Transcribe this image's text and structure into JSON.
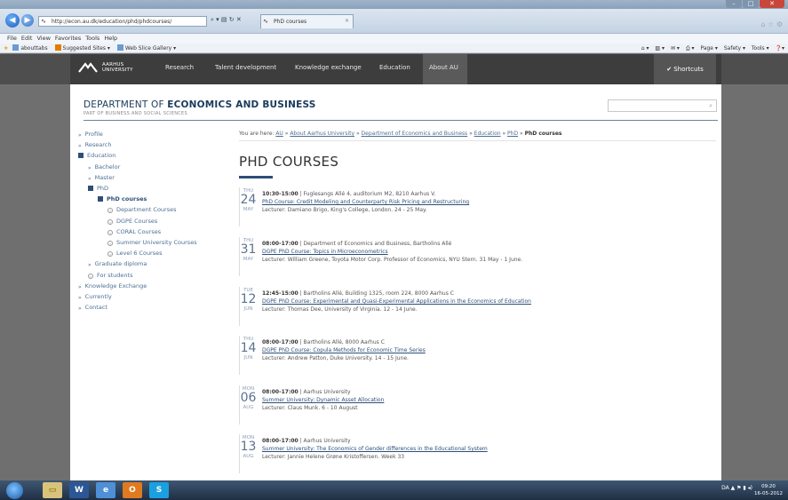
{
  "browser": {
    "url": "http://econ.au.dk/education/phd/phdcourses/",
    "tab_title": "PhD courses",
    "menu": [
      "File",
      "Edit",
      "View",
      "Favorites",
      "Tools",
      "Help"
    ],
    "favorites": [
      "abouttabs",
      "Suggested Sites ▾",
      "Web Slice Gallery ▾"
    ],
    "command_bar": [
      "Page ▾",
      "Safety ▾",
      "Tools ▾"
    ]
  },
  "site": {
    "logo_line1": "AARHUS",
    "logo_line2": "UNIVERSITY",
    "nav": [
      "Research",
      "Talent development",
      "Knowledge exchange",
      "Education",
      "About AU"
    ],
    "shortcuts": "✔ Shortcuts",
    "dept_prefix": "DEPARTMENT OF ",
    "dept_bold": "ECONOMICS AND BUSINESS",
    "faculty": "PART OF BUSINESS AND SOCIAL SCIENCES"
  },
  "sidebar": [
    {
      "label": "Profile",
      "marker": "arrow",
      "indent": 0
    },
    {
      "label": "Research",
      "marker": "arrow",
      "indent": 0
    },
    {
      "label": "Education",
      "marker": "box",
      "indent": 0
    },
    {
      "label": "Bachelor",
      "marker": "arrow",
      "indent": 1
    },
    {
      "label": "Master",
      "marker": "arrow",
      "indent": 1
    },
    {
      "label": "PhD",
      "marker": "box",
      "indent": 1
    },
    {
      "label": "PhD courses",
      "marker": "box",
      "indent": 2
    },
    {
      "label": "Department Courses",
      "marker": "circ",
      "indent": 3
    },
    {
      "label": "DGPE Courses",
      "marker": "circ",
      "indent": 3
    },
    {
      "label": "CORAL Courses",
      "marker": "circ",
      "indent": 3
    },
    {
      "label": "Summer University Courses",
      "marker": "circ",
      "indent": 3
    },
    {
      "label": "Level 6 Courses",
      "marker": "circ",
      "indent": 3
    },
    {
      "label": "Graduate diploma",
      "marker": "arrow",
      "indent": 1
    },
    {
      "label": "For students",
      "marker": "circ",
      "indent": 1
    },
    {
      "label": "Knowledge Exchange",
      "marker": "arrow",
      "indent": 0
    },
    {
      "label": "Currently",
      "marker": "arrow",
      "indent": 0
    },
    {
      "label": "Contact",
      "marker": "arrow",
      "indent": 0
    }
  ],
  "breadcrumb": {
    "prefix": "You are here:",
    "items": [
      "AU",
      "About Aarhus University",
      "Department of Economics and Business",
      "Education",
      "PhD"
    ],
    "current": "PhD courses"
  },
  "page_title": "PHD COURSES",
  "events": [
    {
      "dow": "THU",
      "day": "24",
      "mon": "MAY",
      "time": "10:30-15:00",
      "place": "| Fuglesangs Allé 4, auditorium M2, 8210 Aarhus V.",
      "title": "PhD Course: Credit Modeling and Counterparty Risk Pricing and Restructuring",
      "lecturer": "Lecturer: Damiano Brigo, King's College, London. 24 - 25 May."
    },
    {
      "dow": "THU",
      "day": "31",
      "mon": "MAY",
      "time": "08:00-17:00",
      "place": "| Department of Economics and Business, Bartholins Allé",
      "title": "DGPE PhD Course: Topics in Microeconometrics",
      "lecturer": "Lecturer: William Greene, Toyota Motor Corp. Professor of Economics, NYU Stern. 31 May - 1 June."
    },
    {
      "dow": "TUE",
      "day": "12",
      "mon": "JUN",
      "time": "12:45-15:00",
      "place": "| Bartholins Allé, Building 1325, room 224, 8000 Aarhus C",
      "title": "DGPE PhD Course: Experimental and Quasi-Experimental Applications in the Economics of Education",
      "lecturer": "Lecturer: Thomas Dee, University of Virginia. 12 - 14 June."
    },
    {
      "dow": "THU",
      "day": "14",
      "mon": "JUN",
      "time": "08:00-17:00",
      "place": "| Bartholins Allé, 8000 Aarhus C",
      "title": "DGPE PhD Course: Copula Methods for Economic Time Series",
      "lecturer": "Lecturer: Andrew Patton, Duke University. 14 - 15 June."
    },
    {
      "dow": "MON",
      "day": "06",
      "mon": "AUG",
      "time": "08:00-17:00",
      "place": "| Aarhus University",
      "title": "Summer University: Dynamic Asset Allocation",
      "lecturer": "Lecturer: Claus Munk. 6 - 10 August"
    },
    {
      "dow": "MON",
      "day": "13",
      "mon": "AUG",
      "time": "08:00-17:00",
      "place": "| Aarhus University",
      "title": "Summer University: The Economics of Gender differences in the Educational System",
      "lecturer": "Lecturer: Jannie Helene Grøne Kristoffersen. Week 33"
    }
  ],
  "taskbar": {
    "lang": "DA",
    "time": "09:20",
    "date": "16-05-2012"
  }
}
